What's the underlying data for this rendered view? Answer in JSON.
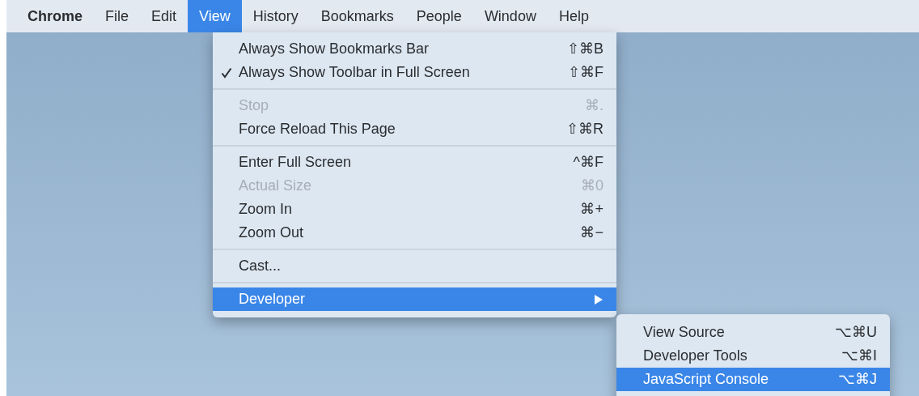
{
  "menu_bar": [
    {
      "label": "Chrome",
      "selected": false,
      "bold": true
    },
    {
      "label": "File",
      "selected": false,
      "bold": false
    },
    {
      "label": "Edit",
      "selected": false,
      "bold": false
    },
    {
      "label": "View",
      "selected": true,
      "bold": false
    },
    {
      "label": "History",
      "selected": false,
      "bold": false
    },
    {
      "label": "Bookmarks",
      "selected": false,
      "bold": false
    },
    {
      "label": "People",
      "selected": false,
      "bold": false
    },
    {
      "label": "Window",
      "selected": false,
      "bold": false
    },
    {
      "label": "Help",
      "selected": false,
      "bold": false
    }
  ],
  "view_menu": [
    {
      "kind": "item",
      "label": "Always Show Bookmarks Bar",
      "shortcut": "⇧⌘B",
      "checked": false,
      "disabled": false,
      "selected": false,
      "submenu": false
    },
    {
      "kind": "item",
      "label": "Always Show Toolbar in Full Screen",
      "shortcut": "⇧⌘F",
      "checked": true,
      "disabled": false,
      "selected": false,
      "submenu": false
    },
    {
      "kind": "separator"
    },
    {
      "kind": "item",
      "label": "Stop",
      "shortcut": "⌘.",
      "checked": false,
      "disabled": true,
      "selected": false,
      "submenu": false
    },
    {
      "kind": "item",
      "label": "Force Reload This Page",
      "shortcut": "⇧⌘R",
      "checked": false,
      "disabled": false,
      "selected": false,
      "submenu": false
    },
    {
      "kind": "separator"
    },
    {
      "kind": "item",
      "label": "Enter Full Screen",
      "shortcut": "^⌘F",
      "checked": false,
      "disabled": false,
      "selected": false,
      "submenu": false
    },
    {
      "kind": "item",
      "label": "Actual Size",
      "shortcut": "⌘0",
      "checked": false,
      "disabled": true,
      "selected": false,
      "submenu": false
    },
    {
      "kind": "item",
      "label": "Zoom In",
      "shortcut": "⌘+",
      "checked": false,
      "disabled": false,
      "selected": false,
      "submenu": false
    },
    {
      "kind": "item",
      "label": "Zoom Out",
      "shortcut": "⌘−",
      "checked": false,
      "disabled": false,
      "selected": false,
      "submenu": false
    },
    {
      "kind": "separator"
    },
    {
      "kind": "item",
      "label": "Cast...",
      "checked": false,
      "disabled": false,
      "selected": false,
      "submenu": false
    },
    {
      "kind": "separator"
    },
    {
      "kind": "item",
      "label": "Developer",
      "checked": false,
      "disabled": false,
      "selected": true,
      "submenu": true
    }
  ],
  "developer_submenu": [
    {
      "label": "View Source",
      "shortcut": "⌥⌘U",
      "selected": false
    },
    {
      "label": "Developer Tools",
      "shortcut": "⌥⌘I",
      "selected": false
    },
    {
      "label": "JavaScript Console",
      "shortcut": "⌥⌘J",
      "selected": true
    }
  ]
}
